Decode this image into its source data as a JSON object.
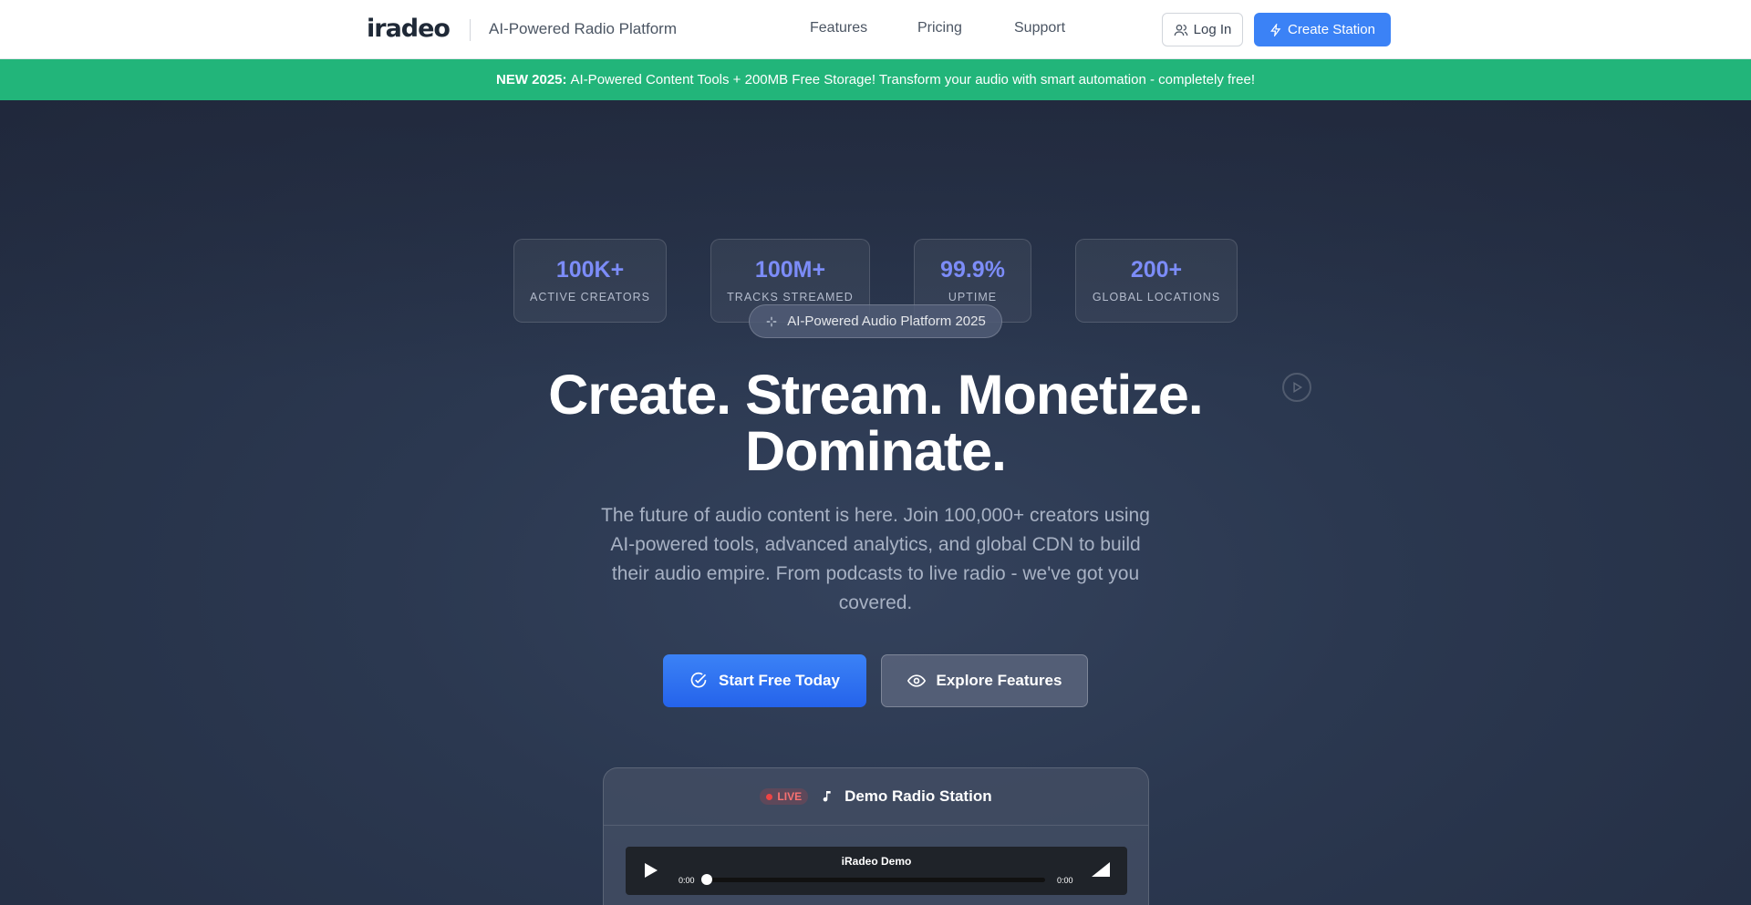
{
  "header": {
    "logo": "iradeo",
    "tagline": "AI-Powered Radio Platform",
    "nav": [
      "Features",
      "Pricing",
      "Support"
    ],
    "login_label": "Log In",
    "create_label": "Create Station"
  },
  "banner": {
    "badge": "NEW 2025:",
    "text": "AI-Powered Content Tools + 200MB Free Storage! Transform your audio with smart automation - completely free!"
  },
  "stats": [
    {
      "value": "100K+",
      "label": "ACTIVE CREATORS"
    },
    {
      "value": "100M+",
      "label": "TRACKS STREAMED"
    },
    {
      "value": "99.9%",
      "label": "UPTIME"
    },
    {
      "value": "200+",
      "label": "GLOBAL LOCATIONS"
    }
  ],
  "hero": {
    "pill": "AI-Powered Audio Platform 2025",
    "headline_line1": "Create. Stream. Monetize.",
    "headline_line2": "Dominate.",
    "subtitle": "The future of audio content is here. Join 100,000+ creators using AI-powered tools, advanced analytics, and global CDN to build their audio empire. From podcasts to live radio - we've got you covered.",
    "cta_primary": "Start Free Today",
    "cta_secondary": "Explore Features"
  },
  "player": {
    "live_label": "LIVE",
    "station_name": "Demo Radio Station",
    "audio_title": "iRadeo Demo",
    "time_current": "0:00",
    "time_total": "0:00",
    "progress": 0
  },
  "colors": {
    "accent": "#3b82f6",
    "banner": "#22b57a",
    "stat_value": "#7c8cf8",
    "live": "#ef4444"
  }
}
